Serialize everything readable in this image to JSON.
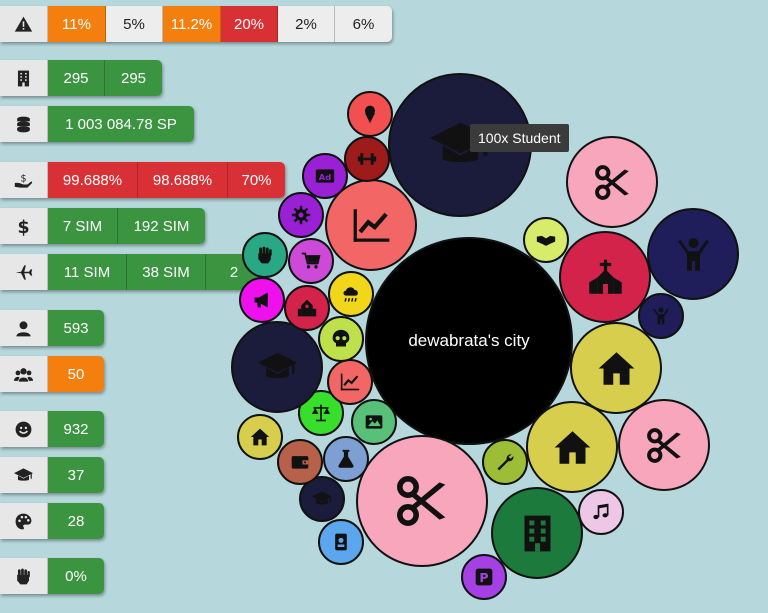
{
  "stats": {
    "risk": {
      "icon": "warning-icon",
      "values": [
        "11%",
        "5%",
        "11.2%",
        "20%",
        "2%",
        "6%"
      ]
    },
    "buildings": {
      "icon": "building-icon",
      "values": [
        "295",
        "295"
      ]
    },
    "money": {
      "icon": "coins-icon",
      "values": [
        "1 003 084.78 SP"
      ]
    },
    "payments": {
      "icon": "hand-money-icon",
      "values": [
        "99.688%",
        "98.688%",
        "70%"
      ]
    },
    "dollars": {
      "icon": "dollar-icon",
      "values": [
        "7 SIM",
        "192 SIM"
      ]
    },
    "flights": {
      "icon": "plane-icon",
      "values": [
        "11 SIM",
        "38 SIM",
        "2"
      ]
    },
    "population": {
      "icon": "user-icon",
      "values": [
        "593"
      ]
    },
    "groups": {
      "icon": "users-icon",
      "values": [
        "50"
      ]
    },
    "happiness": {
      "icon": "smile-icon",
      "values": [
        "932"
      ]
    },
    "education": {
      "icon": "graduation-cap-icon",
      "values": [
        "37"
      ]
    },
    "culture": {
      "icon": "palette-icon",
      "values": [
        "28"
      ]
    },
    "protest": {
      "icon": "fist-icon",
      "values": [
        "0%"
      ]
    }
  },
  "city": {
    "name": "dewabrata's city"
  },
  "tooltip": {
    "text": "100x Student"
  },
  "colors": {
    "green": "#3a9440",
    "orange": "#f57f0e",
    "red": "#d93035",
    "background": "#b6d8dc",
    "center": "#000000"
  },
  "bubbles": [
    {
      "id": "student-large",
      "icon": "graduation-cap-icon",
      "color": "#1b1b3b"
    },
    {
      "id": "city-center",
      "color": "#000000"
    },
    {
      "id": "scissors-pink-top",
      "icon": "scissors-icon",
      "color": "#f7a6bc"
    },
    {
      "id": "worker-navy",
      "icon": "person-arms-up-icon",
      "color": "#1f1d5a"
    },
    {
      "id": "church",
      "icon": "church-icon",
      "color": "#d3234b"
    },
    {
      "id": "worker-navy-small",
      "icon": "person-arms-up-icon",
      "color": "#1f1d5a"
    },
    {
      "id": "house-yellow-large",
      "icon": "house-icon",
      "color": "#d7ce4e"
    },
    {
      "id": "handshake",
      "icon": "handshake-icon",
      "color": "#d7ec6a"
    },
    {
      "id": "scissors-pink-right",
      "icon": "scissors-icon",
      "color": "#f7a6bc"
    },
    {
      "id": "house-yellow",
      "icon": "house-icon",
      "color": "#d7ce4e"
    },
    {
      "id": "wrench",
      "icon": "wrench-icon",
      "color": "#9cbd35"
    },
    {
      "id": "music",
      "icon": "music-icon",
      "color": "#eec7e6"
    },
    {
      "id": "office-green",
      "icon": "office-building-icon",
      "color": "#1b7a3c"
    },
    {
      "id": "scissors-pink-large",
      "icon": "scissors-icon",
      "color": "#f7a6bc"
    },
    {
      "id": "parking",
      "icon": "parking-icon",
      "color": "#a541e4"
    },
    {
      "id": "id-card",
      "icon": "id-card-icon",
      "color": "#5ca6ee"
    },
    {
      "id": "student-small",
      "icon": "graduation-cap-icon",
      "color": "#1b1b3b"
    },
    {
      "id": "flask",
      "icon": "flask-icon",
      "color": "#7e9fd3"
    },
    {
      "id": "wallet",
      "icon": "wallet-icon",
      "color": "#b7604a"
    },
    {
      "id": "image",
      "icon": "image-icon",
      "color": "#58c079"
    },
    {
      "id": "scales",
      "icon": "scales-icon",
      "color": "#38de2c"
    },
    {
      "id": "house-small",
      "icon": "house-icon",
      "color": "#d7ce4e"
    },
    {
      "id": "chart-small",
      "icon": "chart-icon",
      "color": "#f26666"
    },
    {
      "id": "student-mid",
      "icon": "graduation-cap-icon",
      "color": "#1b1b3b"
    },
    {
      "id": "skull",
      "icon": "skull-icon",
      "color": "#bde04b"
    },
    {
      "id": "school-small",
      "icon": "school-icon",
      "color": "#d3234b"
    },
    {
      "id": "megaphone",
      "icon": "megaphone-icon",
      "color": "#ee11ee"
    },
    {
      "id": "cloud-rain",
      "icon": "cloud-rain-icon",
      "color": "#f2d619"
    },
    {
      "id": "cart",
      "icon": "cart-icon",
      "color": "#cd4ad8"
    },
    {
      "id": "fist",
      "icon": "fist-icon",
      "color": "#28a885"
    },
    {
      "id": "chart-large",
      "icon": "chart-icon",
      "color": "#f26666"
    },
    {
      "id": "cog",
      "icon": "cog-icon",
      "color": "#9a20d6"
    },
    {
      "id": "ad",
      "icon": "ad-icon",
      "color": "#9a20d6"
    },
    {
      "id": "dumbbell",
      "icon": "dumbbell-icon",
      "color": "#9e1b1b"
    },
    {
      "id": "icecream",
      "icon": "ice-cream-icon",
      "color": "#f25050"
    }
  ]
}
